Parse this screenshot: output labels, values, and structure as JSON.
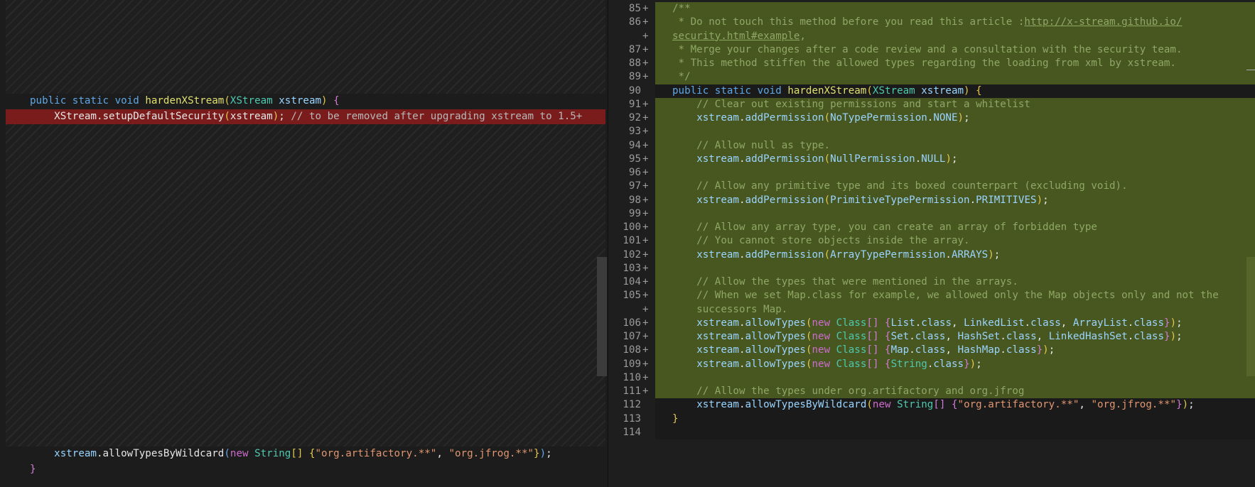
{
  "colors": {
    "added_background": "#48561f",
    "removed_background": "#7a1c1c",
    "keyword": "#5fa7e6",
    "type": "#4ec9b0",
    "string": "#e09670",
    "comment": "#7b9e50"
  },
  "left": {
    "lines": [
      {
        "kind": "context",
        "text": "public static void hardenXStream(XStream xstream) {"
      },
      {
        "kind": "removed",
        "text": "    XStream.setupDefaultSecurity(xstream); // to be removed after upgrading xstream to 1.5+"
      },
      {
        "kind": "context",
        "text": "    xstream.allowTypesByWildcard(new String[] {\"org.artifactory.**\", \"org.jfrog.**\"});"
      },
      {
        "kind": "context",
        "text": "}"
      }
    ]
  },
  "right": {
    "lines": [
      {
        "num": "85",
        "mark": "+",
        "text": "/**"
      },
      {
        "num": "86",
        "mark": "+",
        "text": " * Do not touch this method before you read this article :",
        "link": "http://x-stream.github.io/"
      },
      {
        "num": "",
        "mark": "+",
        "text": "",
        "link": "security.html#example",
        "suffix": ","
      },
      {
        "num": "87",
        "mark": "+",
        "text": " * Merge your changes after a code review and a consultation with the security team."
      },
      {
        "num": "88",
        "mark": "+",
        "text": " * This method stiffen the allowed types regarding the loading from xml by xstream."
      },
      {
        "num": "89",
        "mark": "+",
        "text": " */"
      },
      {
        "num": "90",
        "mark": "",
        "text": "public static void hardenXStream(XStream xstream) {"
      },
      {
        "num": "91",
        "mark": "+",
        "text": "    // Clear out existing permissions and start a whitelist"
      },
      {
        "num": "92",
        "mark": "+",
        "text": "    xstream.addPermission(NoTypePermission.NONE);"
      },
      {
        "num": "93",
        "mark": "+",
        "text": ""
      },
      {
        "num": "94",
        "mark": "+",
        "text": "    // Allow null as type."
      },
      {
        "num": "95",
        "mark": "+",
        "text": "    xstream.addPermission(NullPermission.NULL);"
      },
      {
        "num": "96",
        "mark": "+",
        "text": ""
      },
      {
        "num": "97",
        "mark": "+",
        "text": "    // Allow any primitive type and its boxed counterpart (excluding void)."
      },
      {
        "num": "98",
        "mark": "+",
        "text": "    xstream.addPermission(PrimitiveTypePermission.PRIMITIVES);"
      },
      {
        "num": "99",
        "mark": "+",
        "text": ""
      },
      {
        "num": "100",
        "mark": "+",
        "text": "    // Allow any array type, you can create an array of forbidden type"
      },
      {
        "num": "101",
        "mark": "+",
        "text": "    // You cannot store objects inside the array."
      },
      {
        "num": "102",
        "mark": "+",
        "text": "    xstream.addPermission(ArrayTypePermission.ARRAYS);"
      },
      {
        "num": "103",
        "mark": "+",
        "text": ""
      },
      {
        "num": "104",
        "mark": "+",
        "text": "    // Allow the types that were mentioned in the arrays."
      },
      {
        "num": "105",
        "mark": "+",
        "text": "    // When we set Map.class for example, we allowed only the Map objects only and not the"
      },
      {
        "num": "",
        "mark": "+",
        "text": "    successors Map."
      },
      {
        "num": "106",
        "mark": "+",
        "text": "    xstream.allowTypes(new Class[] {List.class, LinkedList.class, ArrayList.class});"
      },
      {
        "num": "107",
        "mark": "+",
        "text": "    xstream.allowTypes(new Class[] {Set.class, HashSet.class, LinkedHashSet.class});"
      },
      {
        "num": "108",
        "mark": "+",
        "text": "    xstream.allowTypes(new Class[] {Map.class, HashMap.class});"
      },
      {
        "num": "109",
        "mark": "+",
        "text": "    xstream.allowTypes(new Class[] {String.class});"
      },
      {
        "num": "110",
        "mark": "+",
        "text": ""
      },
      {
        "num": "111",
        "mark": "+",
        "text": "    // Allow the types under org.artifactory and org.jfrog"
      },
      {
        "num": "112",
        "mark": "",
        "text": "    xstream.allowTypesByWildcard(new String[] {\"org.artifactory.**\", \"org.jfrog.**\"});"
      },
      {
        "num": "113",
        "mark": "",
        "text": "}"
      },
      {
        "num": "114",
        "mark": "",
        "text": ""
      }
    ]
  }
}
